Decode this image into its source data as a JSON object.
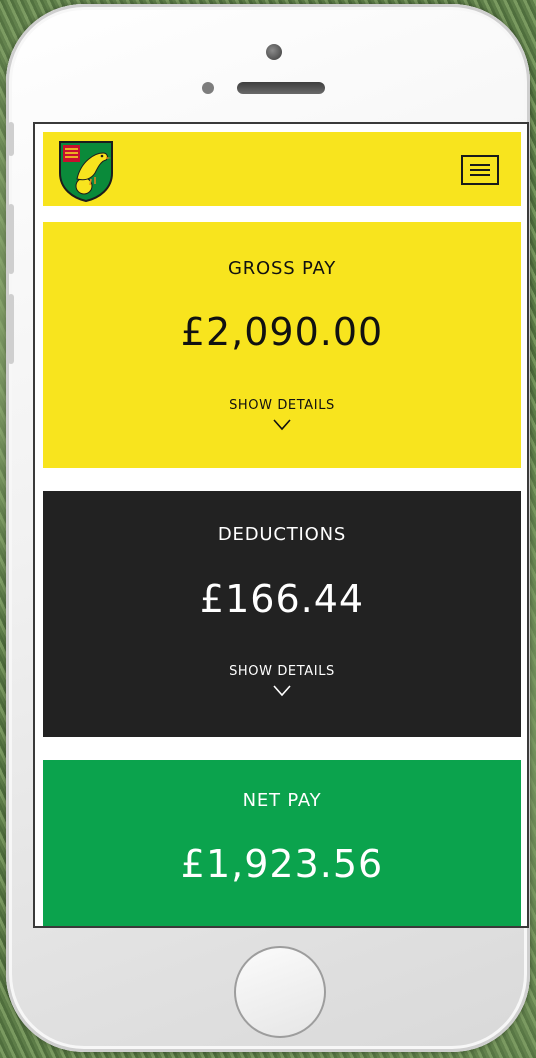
{
  "app": {
    "logo_icon": "club-crest-icon",
    "menu_icon": "hamburger-menu-icon"
  },
  "colors": {
    "header_bg": "#f8e41e",
    "gross_bg": "#f8e41e",
    "deductions_bg": "#222222",
    "net_bg": "#0ba34d"
  },
  "cards": {
    "gross": {
      "title": "GROSS PAY",
      "amount": "£2,090.00",
      "details_label": "SHOW DETAILS"
    },
    "deductions": {
      "title": "DEDUCTIONS",
      "amount": "£166.44",
      "details_label": "SHOW DETAILS"
    },
    "net": {
      "title": "NET PAY",
      "amount": "£1,923.56"
    }
  }
}
